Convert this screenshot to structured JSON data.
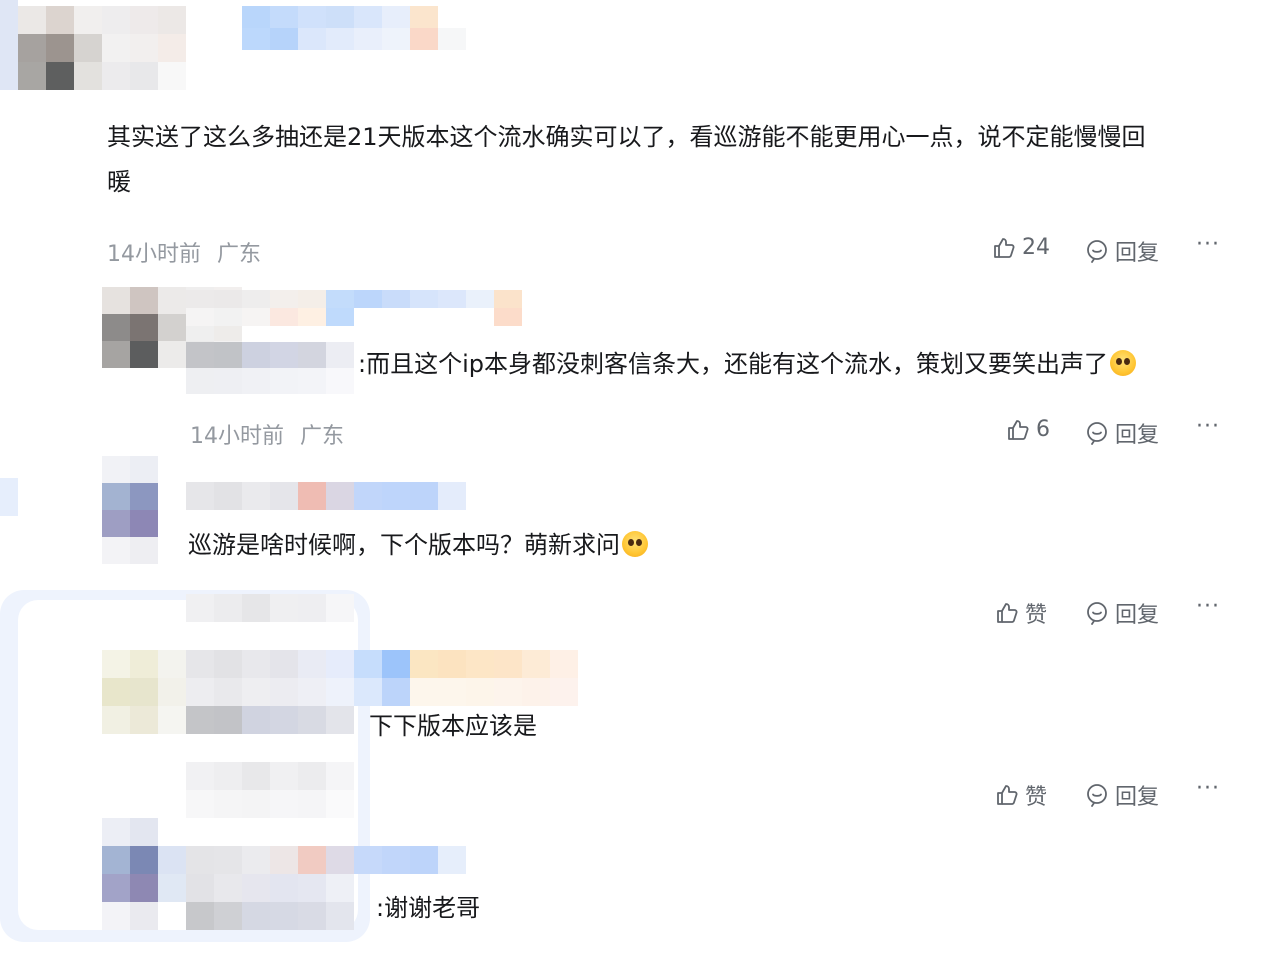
{
  "comments": [
    {
      "text_line1": "其实送了这么多抽还是21天版本这个流水确实可以了，看巡游能不能更用心一点，说不定能慢慢回",
      "text_line2": "暖",
      "time": "14小时前",
      "region": "广东",
      "likes": "24",
      "reply": "回复",
      "more": "···"
    },
    {
      "text": ":而且这个ip本身都没刺客信条大，还能有这个流水，策划又要笑出声了",
      "emoji": "laughing-emoji",
      "time": "14小时前",
      "region": "广东",
      "likes": "6",
      "reply": "回复",
      "more": "···"
    },
    {
      "text": "巡游是啥时候啊，下个版本吗？萌新求问",
      "emoji": "pleading-emoji",
      "likes": "赞",
      "reply": "回复",
      "more": "···"
    },
    {
      "text": "下下版本应该是",
      "likes": "赞",
      "reply": "回复",
      "more": "···"
    },
    {
      "text": ":谢谢老哥"
    }
  ],
  "colors": {
    "text": "#18191c",
    "meta": "#9499a0",
    "action": "#61666d"
  }
}
